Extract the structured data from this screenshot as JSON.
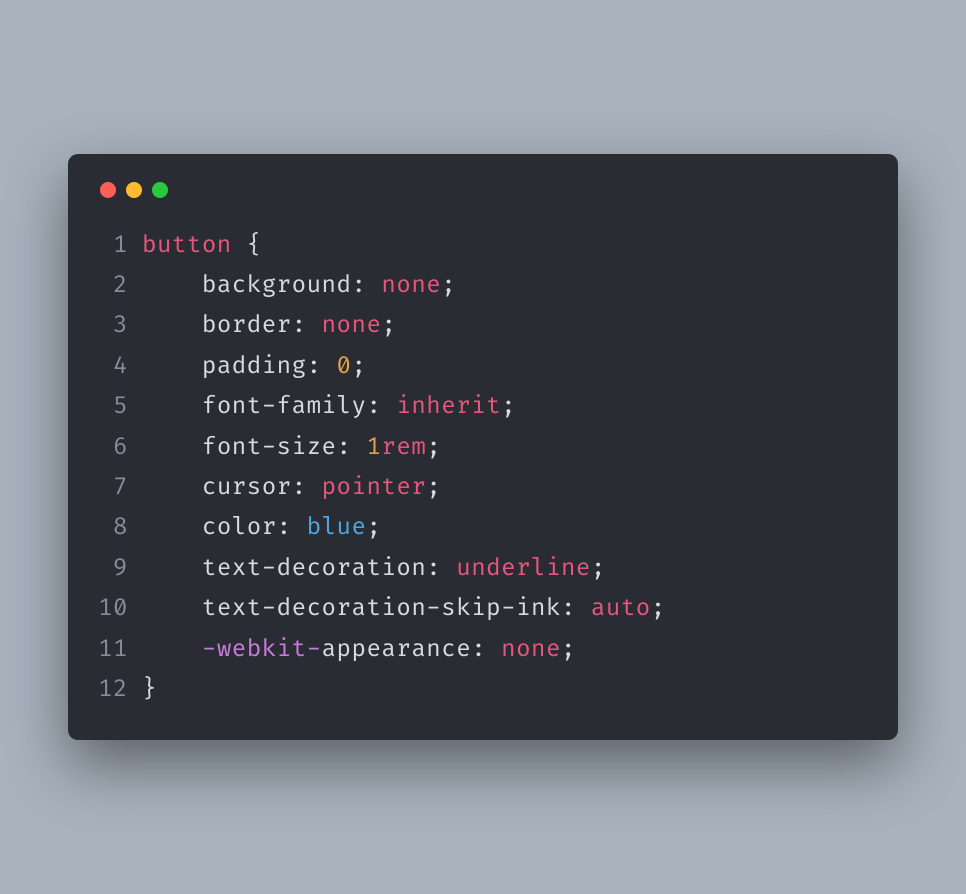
{
  "traffic_lights": [
    "close",
    "minimize",
    "maximize"
  ],
  "code": {
    "language": "css",
    "line_numbers": [
      "1",
      "2",
      "3",
      "4",
      "5",
      "6",
      "7",
      "8",
      "9",
      "10",
      "11",
      "12"
    ],
    "lines": [
      {
        "n": "1",
        "tokens": [
          [
            "selector",
            "button"
          ],
          [
            "punct",
            " {"
          ]
        ]
      },
      {
        "n": "2",
        "tokens": [
          [
            "indent",
            "    "
          ],
          [
            "prop",
            "background"
          ],
          [
            "punct",
            ": "
          ],
          [
            "kw",
            "none"
          ],
          [
            "punct",
            ";"
          ]
        ]
      },
      {
        "n": "3",
        "tokens": [
          [
            "indent",
            "    "
          ],
          [
            "prop",
            "border"
          ],
          [
            "punct",
            ": "
          ],
          [
            "kw",
            "none"
          ],
          [
            "punct",
            ";"
          ]
        ]
      },
      {
        "n": "4",
        "tokens": [
          [
            "indent",
            "    "
          ],
          [
            "prop",
            "padding"
          ],
          [
            "punct",
            ": "
          ],
          [
            "num",
            "0"
          ],
          [
            "punct",
            ";"
          ]
        ]
      },
      {
        "n": "5",
        "tokens": [
          [
            "indent",
            "    "
          ],
          [
            "prop",
            "font-family"
          ],
          [
            "punct",
            ": "
          ],
          [
            "kw",
            "inherit"
          ],
          [
            "punct",
            ";"
          ]
        ]
      },
      {
        "n": "6",
        "tokens": [
          [
            "indent",
            "    "
          ],
          [
            "prop",
            "font-size"
          ],
          [
            "punct",
            ": "
          ],
          [
            "num",
            "1"
          ],
          [
            "unit",
            "rem"
          ],
          [
            "punct",
            ";"
          ]
        ]
      },
      {
        "n": "7",
        "tokens": [
          [
            "indent",
            "    "
          ],
          [
            "prop",
            "cursor"
          ],
          [
            "punct",
            ": "
          ],
          [
            "kw",
            "pointer"
          ],
          [
            "punct",
            ";"
          ]
        ]
      },
      {
        "n": "8",
        "tokens": [
          [
            "indent",
            "    "
          ],
          [
            "prop",
            "color"
          ],
          [
            "punct",
            ": "
          ],
          [
            "ident",
            "blue"
          ],
          [
            "punct",
            ";"
          ]
        ]
      },
      {
        "n": "9",
        "tokens": [
          [
            "indent",
            "    "
          ],
          [
            "prop",
            "text-decoration"
          ],
          [
            "punct",
            ": "
          ],
          [
            "kw",
            "underline"
          ],
          [
            "punct",
            ";"
          ]
        ]
      },
      {
        "n": "10",
        "tokens": [
          [
            "indent",
            "    "
          ],
          [
            "prop",
            "text-decoration-skip-ink"
          ],
          [
            "punct",
            ": "
          ],
          [
            "kw",
            "auto"
          ],
          [
            "punct",
            ";"
          ]
        ]
      },
      {
        "n": "11",
        "tokens": [
          [
            "indent",
            "    "
          ],
          [
            "prefix",
            "-webkit-"
          ],
          [
            "prop",
            "appearance"
          ],
          [
            "punct",
            ": "
          ],
          [
            "kw",
            "none"
          ],
          [
            "punct",
            ";"
          ]
        ]
      },
      {
        "n": "12",
        "tokens": [
          [
            "punct",
            "}"
          ]
        ]
      }
    ]
  }
}
